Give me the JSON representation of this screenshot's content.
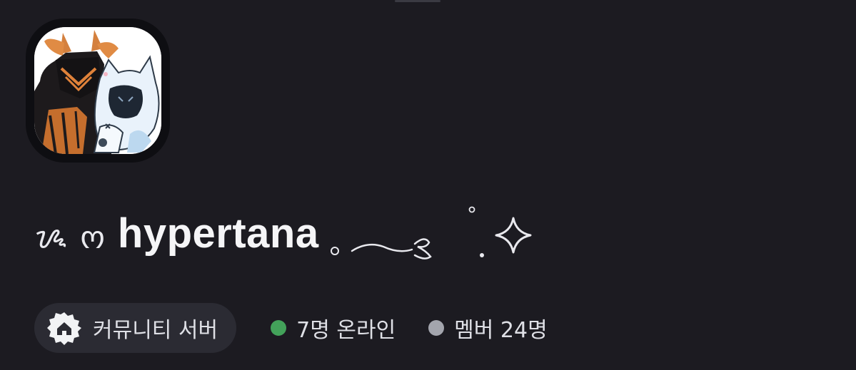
{
  "server": {
    "name": "hypertana",
    "name_prefix": "ᝰ ო",
    "name_suffix_decoration": "ₒ ‿︵ ⊱  ˚. ✧",
    "icon": "server-avatar-image"
  },
  "community_badge": {
    "icon": "community-home-icon",
    "label": "커뮤니티 서버"
  },
  "stats": {
    "online_label": "7명 온라인",
    "members_label": "멤버 24명"
  },
  "colors": {
    "background": "#1c1b21",
    "pill_background": "#2b2b33",
    "online_dot": "#43a25a",
    "members_dot": "#a3a5ad",
    "text_primary": "#f5f5f7",
    "text_secondary": "#dfe0e6"
  }
}
